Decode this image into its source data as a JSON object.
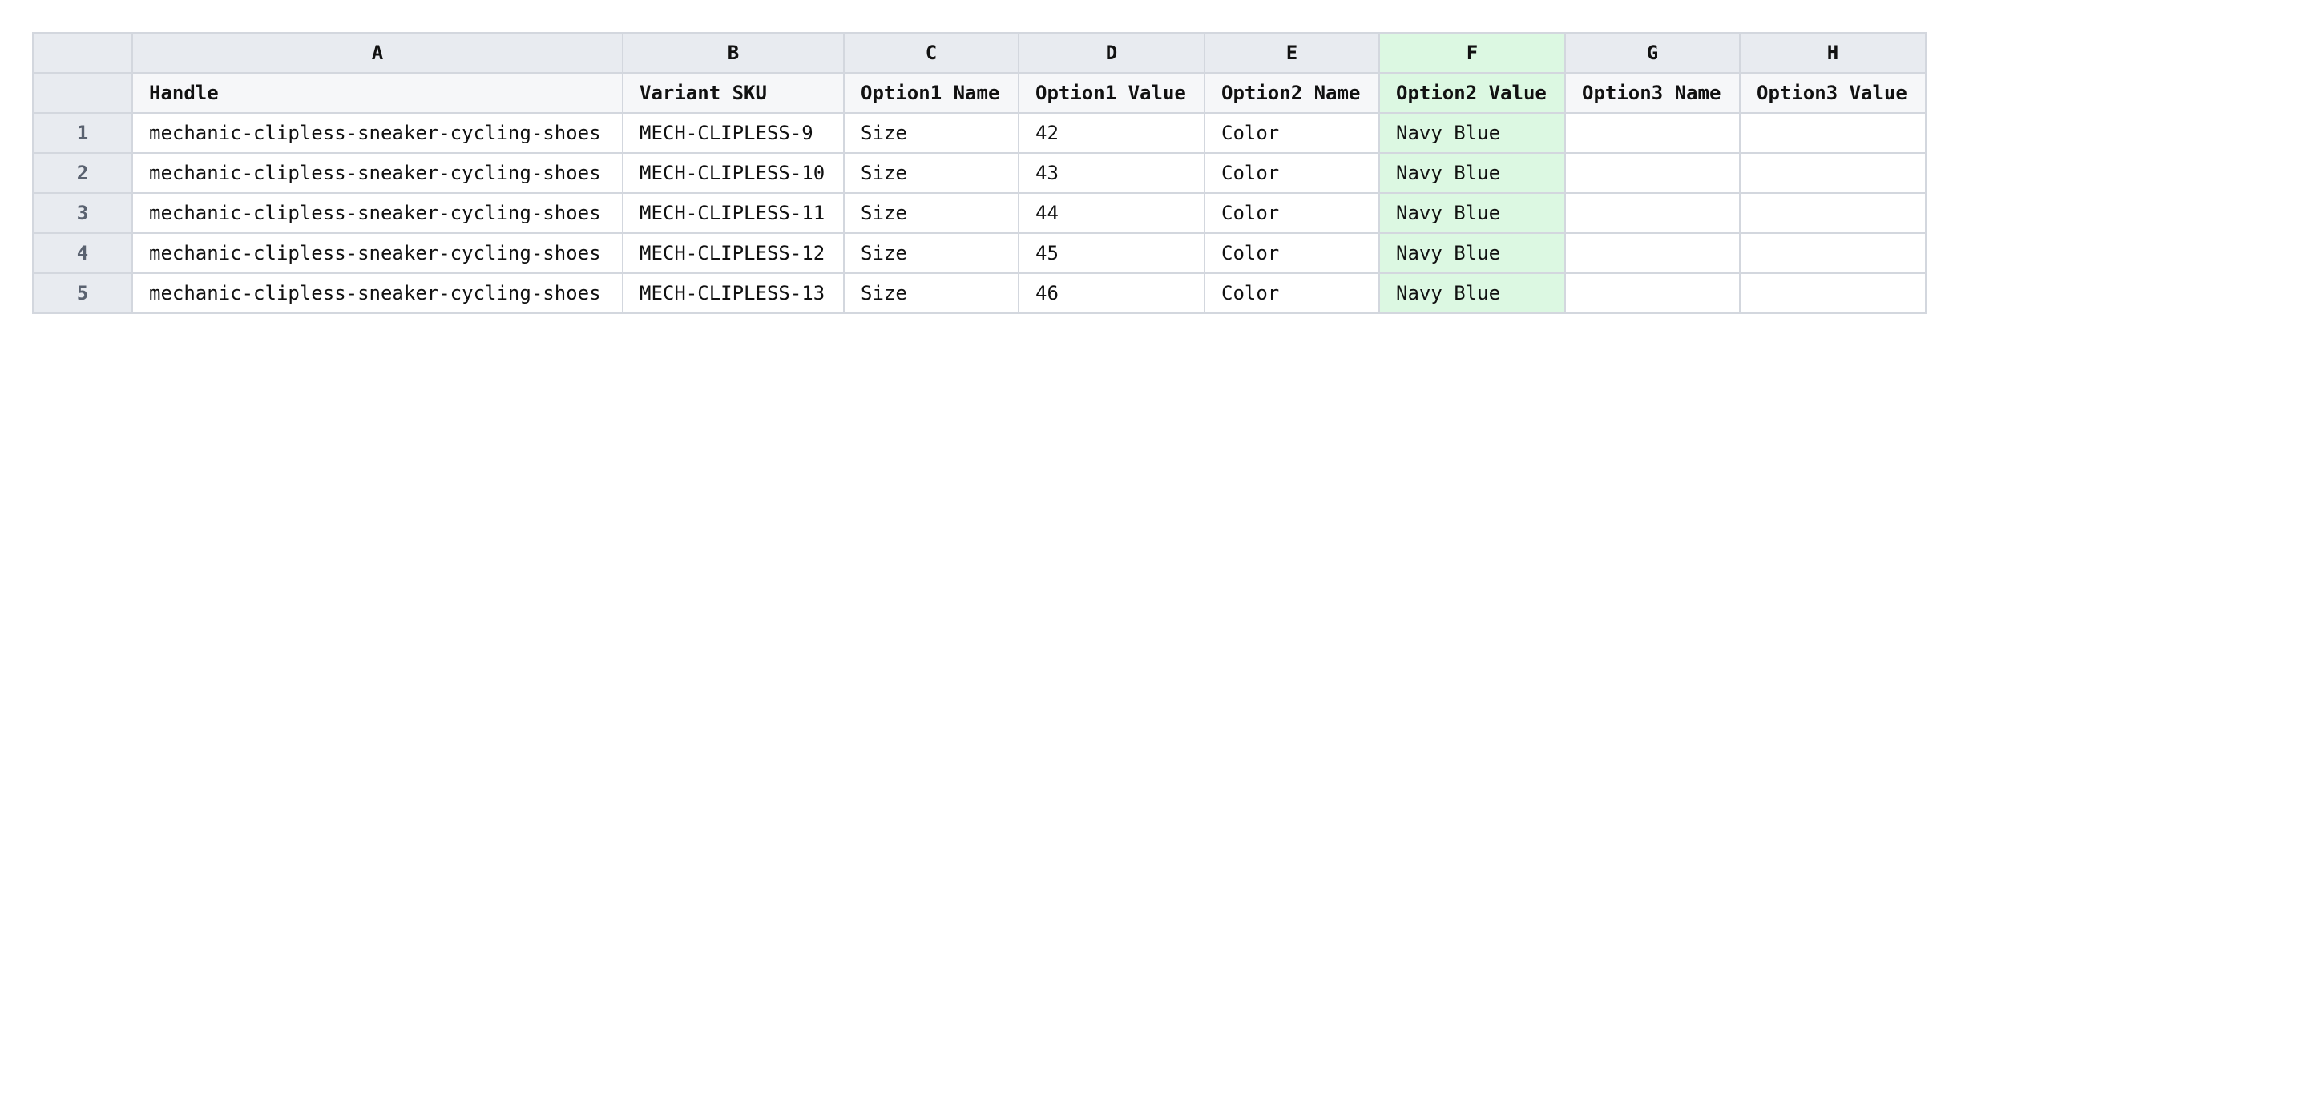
{
  "sheet": {
    "highlight_color": "#dcf8e2",
    "highlighted_column": "F",
    "column_letters": [
      "A",
      "B",
      "C",
      "D",
      "E",
      "F",
      "G",
      "H"
    ],
    "headers": [
      "Handle",
      "Variant SKU",
      "Option1 Name",
      "Option1 Value",
      "Option2 Name",
      "Option2 Value",
      "Option3 Name",
      "Option3 Value"
    ],
    "rows": [
      {
        "num": "1",
        "cells": [
          "mechanic-clipless-sneaker-cycling-shoes",
          "MECH-CLIPLESS-9",
          "Size",
          "42",
          "Color",
          "Navy Blue",
          "",
          ""
        ]
      },
      {
        "num": "2",
        "cells": [
          "mechanic-clipless-sneaker-cycling-shoes",
          "MECH-CLIPLESS-10",
          "Size",
          "43",
          "Color",
          "Navy Blue",
          "",
          ""
        ]
      },
      {
        "num": "3",
        "cells": [
          "mechanic-clipless-sneaker-cycling-shoes",
          "MECH-CLIPLESS-11",
          "Size",
          "44",
          "Color",
          "Navy Blue",
          "",
          ""
        ]
      },
      {
        "num": "4",
        "cells": [
          "mechanic-clipless-sneaker-cycling-shoes",
          "MECH-CLIPLESS-12",
          "Size",
          "45",
          "Color",
          "Navy Blue",
          "",
          ""
        ]
      },
      {
        "num": "5",
        "cells": [
          "mechanic-clipless-sneaker-cycling-shoes",
          "MECH-CLIPLESS-13",
          "Size",
          "46",
          "Color",
          "Navy Blue",
          "",
          ""
        ]
      }
    ]
  }
}
